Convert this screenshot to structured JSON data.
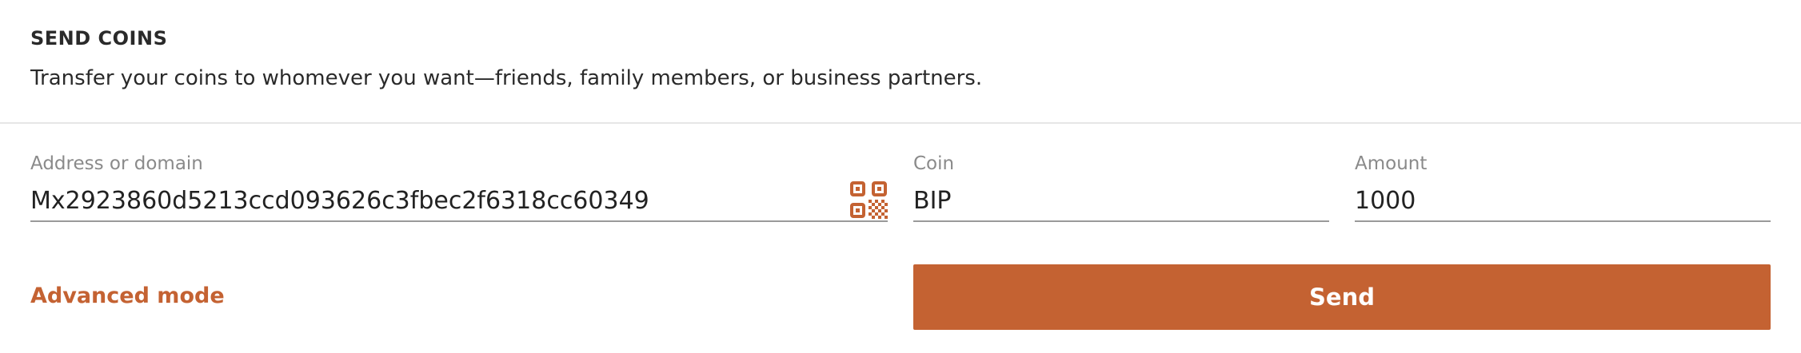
{
  "header": {
    "title": "SEND COINS",
    "subtitle": "Transfer your coins to whomever you want—friends, family members, or business partners."
  },
  "form": {
    "address": {
      "label": "Address or domain",
      "value": "Mx2923860d5213ccd093626c3fbec2f6318cc60349",
      "icon": "qr-code-icon"
    },
    "coin": {
      "label": "Coin",
      "value": "BIP"
    },
    "amount": {
      "label": "Amount",
      "value": "1000"
    },
    "advanced_mode_label": "Advanced mode",
    "send_label": "Send"
  },
  "colors": {
    "accent": "#c46232",
    "text": "#2a2a2a",
    "label": "#8a8a8a",
    "underline": "#9a9a9a",
    "divider": "#e6e6e6"
  }
}
